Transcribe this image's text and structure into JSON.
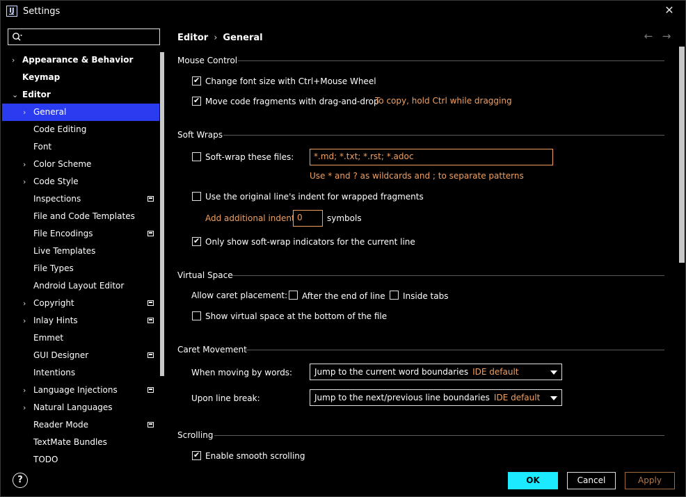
{
  "window": {
    "title": "Settings"
  },
  "search": {
    "placeholder": "",
    "value": ""
  },
  "tree": [
    {
      "label": "Appearance & Behavior",
      "bold": true,
      "arrow": "›",
      "level": 0
    },
    {
      "label": "Keymap",
      "bold": true,
      "arrow": "",
      "level": 0
    },
    {
      "label": "Editor",
      "bold": true,
      "arrow": "⌄",
      "level": 0
    },
    {
      "label": "General",
      "bold": false,
      "arrow": "›",
      "level": 1,
      "selected": true
    },
    {
      "label": "Code Editing",
      "bold": false,
      "arrow": "",
      "level": 1
    },
    {
      "label": "Font",
      "bold": false,
      "arrow": "",
      "level": 1
    },
    {
      "label": "Color Scheme",
      "bold": false,
      "arrow": "›",
      "level": 1
    },
    {
      "label": "Code Style",
      "bold": false,
      "arrow": "›",
      "level": 1
    },
    {
      "label": "Inspections",
      "bold": false,
      "arrow": "",
      "level": 1,
      "mark": true
    },
    {
      "label": "File and Code Templates",
      "bold": false,
      "arrow": "",
      "level": 1
    },
    {
      "label": "File Encodings",
      "bold": false,
      "arrow": "",
      "level": 1,
      "mark": true
    },
    {
      "label": "Live Templates",
      "bold": false,
      "arrow": "",
      "level": 1
    },
    {
      "label": "File Types",
      "bold": false,
      "arrow": "",
      "level": 1
    },
    {
      "label": "Android Layout Editor",
      "bold": false,
      "arrow": "",
      "level": 1
    },
    {
      "label": "Copyright",
      "bold": false,
      "arrow": "›",
      "level": 1,
      "mark": true
    },
    {
      "label": "Inlay Hints",
      "bold": false,
      "arrow": "›",
      "level": 1,
      "mark": true
    },
    {
      "label": "Emmet",
      "bold": false,
      "arrow": "",
      "level": 1
    },
    {
      "label": "GUI Designer",
      "bold": false,
      "arrow": "",
      "level": 1,
      "mark": true
    },
    {
      "label": "Intentions",
      "bold": false,
      "arrow": "",
      "level": 1
    },
    {
      "label": "Language Injections",
      "bold": false,
      "arrow": "›",
      "level": 1,
      "mark": true
    },
    {
      "label": "Natural Languages",
      "bold": false,
      "arrow": "›",
      "level": 1
    },
    {
      "label": "Reader Mode",
      "bold": false,
      "arrow": "",
      "level": 1,
      "mark": true
    },
    {
      "label": "TextMate Bundles",
      "bold": false,
      "arrow": "",
      "level": 1
    },
    {
      "label": "TODO",
      "bold": false,
      "arrow": "",
      "level": 1
    }
  ],
  "breadcrumb": {
    "parent": "Editor",
    "separator": "›",
    "current": "General"
  },
  "nav": {
    "back": "←",
    "forward": "→"
  },
  "sections": {
    "mouse_control": {
      "title": "Mouse Control",
      "change_font_size": {
        "label": "Change font size with Ctrl+Mouse Wheel",
        "checked": true
      },
      "move_code_fragments": {
        "label": "Move code fragments with drag-and-drop",
        "checked": true
      },
      "copy_hint": "To copy, hold Ctrl while dragging"
    },
    "soft_wraps": {
      "title": "Soft Wraps",
      "soft_wrap_files": {
        "label": "Soft-wrap these files:",
        "checked": false
      },
      "files_value": "*.md; *.txt; *.rst; *.adoc",
      "wildcard_hint": "Use * and ? as wildcards and ; to separate patterns",
      "original_indent": {
        "label": "Use the original line's indent for wrapped fragments",
        "checked": false
      },
      "additional_indent_label": "Add additional indent:",
      "additional_indent_value": "0",
      "symbols_label": "symbols",
      "only_show_indicators": {
        "label": "Only show soft-wrap indicators for the current line",
        "checked": true
      }
    },
    "virtual_space": {
      "title": "Virtual Space",
      "allow_caret_label": "Allow caret placement:",
      "after_end_of_line": {
        "label": "After the end of line",
        "checked": false
      },
      "inside_tabs": {
        "label": "Inside tabs",
        "checked": false
      },
      "show_virtual_space": {
        "label": "Show virtual space at the bottom of the file",
        "checked": false
      }
    },
    "caret_movement": {
      "title": "Caret Movement",
      "moving_by_words_label": "When moving by words:",
      "moving_by_words_value": "Jump to the current word boundaries",
      "moving_by_words_tag": "IDE default",
      "line_break_label": "Upon line break:",
      "line_break_value": "Jump to the next/previous line boundaries",
      "line_break_tag": "IDE default"
    },
    "scrolling": {
      "title": "Scrolling",
      "smooth_scrolling": {
        "label": "Enable smooth scrolling",
        "checked": true
      }
    }
  },
  "footer": {
    "help": "?",
    "ok": "OK",
    "cancel": "Cancel",
    "apply": "Apply"
  },
  "colors": {
    "selection": "#2b3cf0",
    "ok_button": "#1ceaff",
    "hint": "#f0a060",
    "background": "#000000"
  }
}
